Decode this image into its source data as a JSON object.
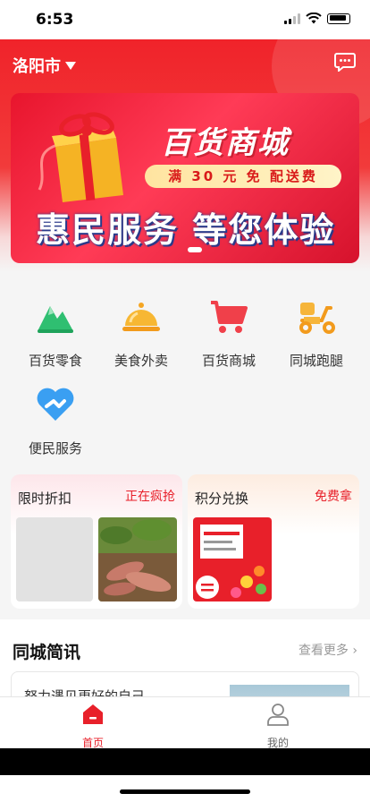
{
  "status": {
    "time": "6:53"
  },
  "header": {
    "city": "洛阳市"
  },
  "banner": {
    "title": "百货商城",
    "subtitle": "满 30 元 免 配送费",
    "slogan": "惠民服务 等您体验"
  },
  "services": [
    {
      "label": "百货零食",
      "icon": "mountain-icon"
    },
    {
      "label": "美食外卖",
      "icon": "food-cloche-icon"
    },
    {
      "label": "百货商城",
      "icon": "shopping-cart-icon"
    },
    {
      "label": "同城跑腿",
      "icon": "scooter-icon"
    },
    {
      "label": "便民服务",
      "icon": "heart-handshake-icon"
    }
  ],
  "promos": {
    "left": {
      "title": "限时折扣",
      "tag": "正在疯抢"
    },
    "right": {
      "title": "积分兑换",
      "tag": "免费拿"
    }
  },
  "news": {
    "title": "同城简讯",
    "more": "查看更多",
    "item_text": "努力遇见更好的自己"
  },
  "tabbar": {
    "home": "首页",
    "mine": "我的"
  },
  "colors": {
    "brand": "#f0232a",
    "accent_text": "#e8202a"
  }
}
